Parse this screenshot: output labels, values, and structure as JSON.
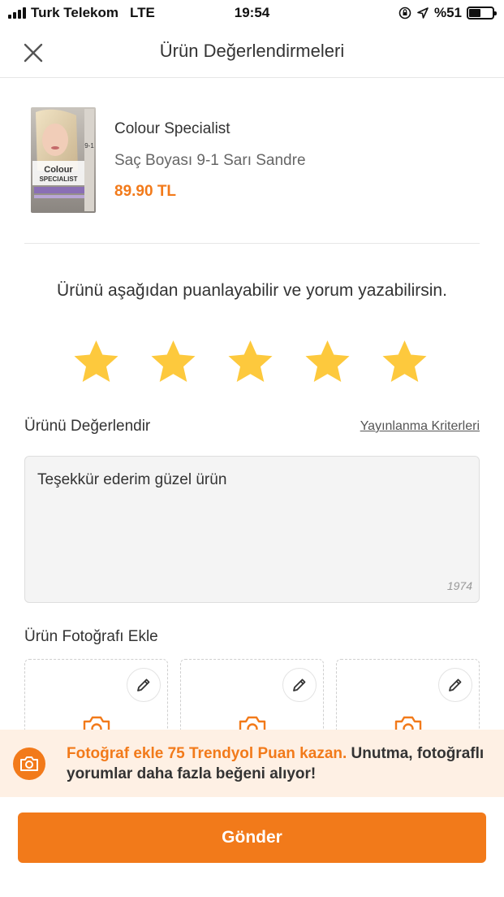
{
  "status_bar": {
    "carrier": "Turk Telekom",
    "network": "LTE",
    "time": "19:54",
    "battery": "%51",
    "battery_level": 0.51
  },
  "header": {
    "title": "Ürün Değerlendirmeleri",
    "close_icon": "close-icon"
  },
  "product": {
    "brand": "Colour Specialist",
    "name": "Saç Boyası 9-1 Sarı Sandre",
    "price": "89.90 TL",
    "image_text_line1": "Colour",
    "image_text_line2": "SPECIALIST",
    "image_shade": "9-1"
  },
  "rating": {
    "prompt": "Ürünü aşağıdan puanlayabilir ve yorum yazabilirsin.",
    "stars_selected": 5,
    "stars_total": 5,
    "star_color": "#fdc93d"
  },
  "review": {
    "label": "Ürünü Değerlendir",
    "criteria_link": "Yayınlanma Kriterleri",
    "text": "Teşekkür ederim güzel ürün",
    "remaining_chars": "1974"
  },
  "photos": {
    "label": "Ürün Fotoğrafı Ekle",
    "slot_count": 3
  },
  "banner": {
    "highlight": "Fotoğraf ekle 75 Trendyol Puan kazan.",
    "text": " Unutma, fotoğraflı yorumlar daha fazla beğeni alıyor!"
  },
  "submit": {
    "label": "Gönder"
  },
  "colors": {
    "accent": "#f27a1a",
    "banner_bg": "#fef0e4"
  }
}
